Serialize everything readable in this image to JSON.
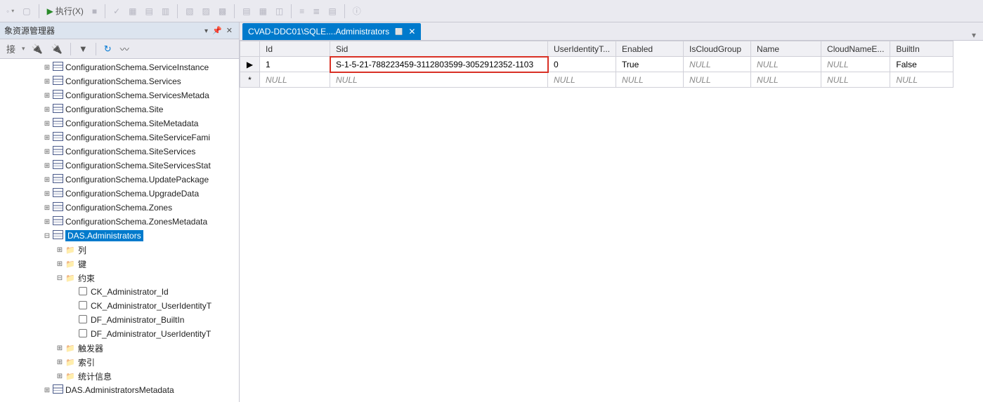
{
  "toolbar": {
    "execute_label": "执行(X)"
  },
  "sidebar": {
    "title": "象资源管理器",
    "connect_label": "接",
    "nodes": [
      {
        "depth": 0,
        "exp": "+",
        "type": "table",
        "label": "ConfigurationSchema.ServiceInstance"
      },
      {
        "depth": 0,
        "exp": "+",
        "type": "table",
        "label": "ConfigurationSchema.Services"
      },
      {
        "depth": 0,
        "exp": "+",
        "type": "table",
        "label": "ConfigurationSchema.ServicesMetada"
      },
      {
        "depth": 0,
        "exp": "+",
        "type": "table",
        "label": "ConfigurationSchema.Site"
      },
      {
        "depth": 0,
        "exp": "+",
        "type": "table",
        "label": "ConfigurationSchema.SiteMetadata"
      },
      {
        "depth": 0,
        "exp": "+",
        "type": "table",
        "label": "ConfigurationSchema.SiteServiceFami"
      },
      {
        "depth": 0,
        "exp": "+",
        "type": "table",
        "label": "ConfigurationSchema.SiteServices"
      },
      {
        "depth": 0,
        "exp": "+",
        "type": "table",
        "label": "ConfigurationSchema.SiteServicesStat"
      },
      {
        "depth": 0,
        "exp": "+",
        "type": "table",
        "label": "ConfigurationSchema.UpdatePackage"
      },
      {
        "depth": 0,
        "exp": "+",
        "type": "table",
        "label": "ConfigurationSchema.UpgradeData"
      },
      {
        "depth": 0,
        "exp": "+",
        "type": "table",
        "label": "ConfigurationSchema.Zones"
      },
      {
        "depth": 0,
        "exp": "+",
        "type": "table",
        "label": "ConfigurationSchema.ZonesMetadata"
      },
      {
        "depth": 0,
        "exp": "-",
        "type": "table",
        "label": "DAS.Administrators",
        "selected": true
      },
      {
        "depth": 1,
        "exp": "+",
        "type": "folder",
        "label": "列"
      },
      {
        "depth": 1,
        "exp": "+",
        "type": "folder",
        "label": "键"
      },
      {
        "depth": 1,
        "exp": "-",
        "type": "folder",
        "label": "约束"
      },
      {
        "depth": 2,
        "exp": "",
        "type": "constraint",
        "label": "CK_Administrator_Id"
      },
      {
        "depth": 2,
        "exp": "",
        "type": "constraint",
        "label": "CK_Administrator_UserIdentityT"
      },
      {
        "depth": 2,
        "exp": "",
        "type": "constraint",
        "label": "DF_Administrator_BuiltIn"
      },
      {
        "depth": 2,
        "exp": "",
        "type": "constraint",
        "label": "DF_Administrator_UserIdentityT"
      },
      {
        "depth": 1,
        "exp": "+",
        "type": "folder",
        "label": "触发器"
      },
      {
        "depth": 1,
        "exp": "+",
        "type": "folder",
        "label": "索引"
      },
      {
        "depth": 1,
        "exp": "+",
        "type": "folder",
        "label": "统计信息"
      },
      {
        "depth": 0,
        "exp": "+",
        "type": "table",
        "label": "DAS.AdministratorsMetadata"
      }
    ]
  },
  "tab": {
    "title": "CVAD-DDC01\\SQLE....Administrators"
  },
  "grid": {
    "columns": [
      "Id",
      "Sid",
      "UserIdentityT...",
      "Enabled",
      "IsCloudGroup",
      "Name",
      "CloudNameE...",
      "BuiltIn"
    ],
    "rows": [
      {
        "marker": "▶",
        "Id": "1",
        "Sid": "S-1-5-21-788223459-3112803599-3052912352-1103",
        "UserIdentityT": "0",
        "Enabled": "True",
        "IsCloudGroup": "NULL",
        "Name": "NULL",
        "CloudNameE": "NULL",
        "BuiltIn": "False",
        "hl": "Sid"
      },
      {
        "marker": "*",
        "Id": "NULL",
        "Sid": "NULL",
        "UserIdentityT": "NULL",
        "Enabled": "NULL",
        "IsCloudGroup": "NULL",
        "Name": "NULL",
        "CloudNameE": "NULL",
        "BuiltIn": "NULL"
      }
    ]
  }
}
